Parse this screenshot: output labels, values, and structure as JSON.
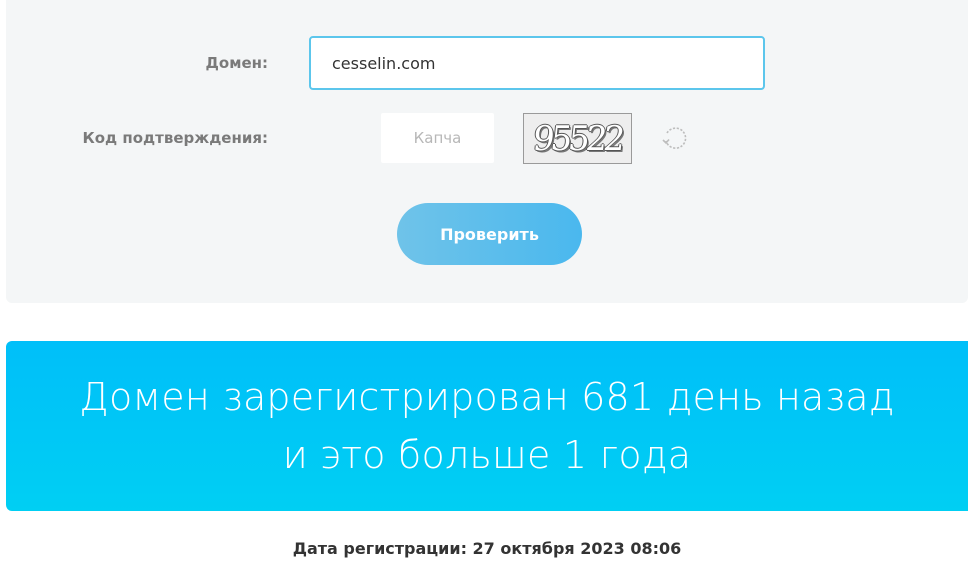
{
  "form": {
    "domain_label": "Домен:",
    "domain_value": "cesselin.com",
    "code_label": "Код подтверждения:",
    "captcha_placeholder": "Капча",
    "captcha_image_text": "95522",
    "check_button_label": "Проверить"
  },
  "result": {
    "line1": "Домен зарегистрирован 681 день назад",
    "line2": "и это больше 1 года"
  },
  "registration": {
    "text": "Дата регистрации: 27 октября 2023 08:06"
  },
  "colors": {
    "accent": "#5cc6ec",
    "banner": "#00c5f7",
    "button": "#55bdec"
  },
  "icons": {
    "refresh": "refresh-icon"
  }
}
